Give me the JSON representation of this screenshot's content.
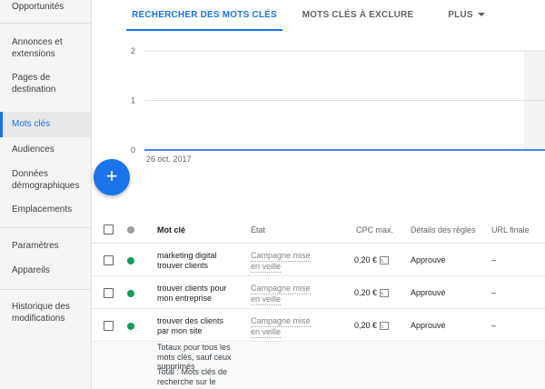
{
  "sidebar": {
    "items": [
      {
        "label": "Opportunités"
      },
      {
        "label": "Annonces et extensions"
      },
      {
        "label": "Pages de destination"
      },
      {
        "label": "Mots clés",
        "active": true
      },
      {
        "label": "Audiences"
      },
      {
        "label": "Données démographiques"
      },
      {
        "label": "Emplacements"
      },
      {
        "label": "Paramètres"
      },
      {
        "label": "Appareils"
      },
      {
        "label": "Historique des modifications"
      }
    ]
  },
  "tabs": [
    {
      "label": "RECHERCHER DES MOTS CLÉS",
      "active": true
    },
    {
      "label": "MOTS CLÉS À EXCLURE"
    },
    {
      "label": "PLUS"
    }
  ],
  "chart_data": {
    "type": "line",
    "y_ticks": [
      "2",
      "1",
      "0"
    ],
    "ylim": [
      0,
      2
    ],
    "x_label_start": "26 oct. 2017",
    "series": [
      {
        "values": [
          0,
          0
        ]
      }
    ],
    "grid": true,
    "line_color": "#4285f4"
  },
  "fab": {
    "label": "+"
  },
  "table": {
    "headers": {
      "keyword": "Mot clé",
      "state": "État",
      "cpc": "CPC max.",
      "rules": "Détails des règles",
      "url": "URL finale"
    },
    "rows": [
      {
        "keyword_l1": "marketing digital",
        "keyword_l2": "trouver clients",
        "state_l1": "Campagne mise",
        "state_l2": "en veille",
        "cpc": "0,20 €",
        "rules": "Approuvé",
        "url": "–"
      },
      {
        "keyword_l1": "trouver clients pour",
        "keyword_l2": "mon entreprise",
        "state_l1": "Campagne mise",
        "state_l2": "en veille",
        "cpc": "0,20 €",
        "rules": "Approuvé",
        "url": "–"
      },
      {
        "keyword_l1": "trouver des clients",
        "keyword_l2": "par mon site",
        "state_l1": "Campagne mise",
        "state_l2": "en veille",
        "cpc": "0,20 €",
        "rules": "Approuvé",
        "url": "–"
      }
    ],
    "totals": {
      "line1_a": "Totaux pour tous les",
      "line1_b": "mots clés, sauf ceux",
      "line1_c": "supprimés",
      "line2_a": "Total : Mots clés de",
      "line2_b": "recherche sur le"
    }
  },
  "colors": {
    "accent": "#1a73e8",
    "status_green": "#0f9d58",
    "status_grey": "#9e9e9e"
  }
}
